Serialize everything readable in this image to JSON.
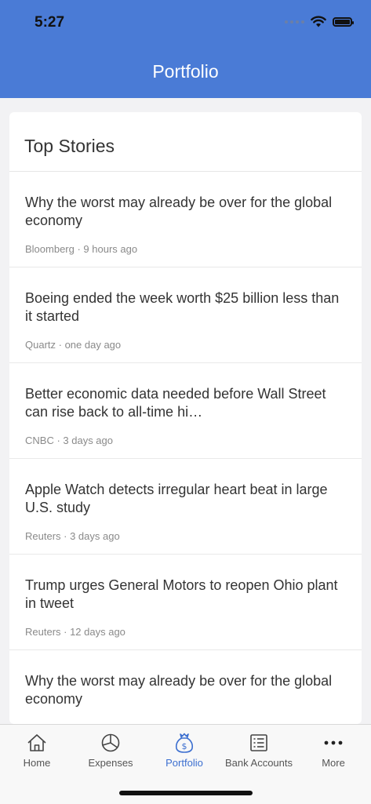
{
  "status_bar": {
    "time": "5:27"
  },
  "header": {
    "title": "Portfolio"
  },
  "section": {
    "title": "Top Stories"
  },
  "stories": [
    {
      "title": "Why the worst may already be over for the global economy",
      "meta": "Bloomberg · 9 hours ago"
    },
    {
      "title": "Boeing ended the week worth $25 billion less than it started",
      "meta": "Quartz · one day ago"
    },
    {
      "title": "Better economic data needed before Wall Street can rise back to all-time hi…",
      "meta": "CNBC · 3 days ago"
    },
    {
      "title": "Apple Watch detects irregular heart beat in large U.S. study",
      "meta": "Reuters · 3 days ago"
    },
    {
      "title": "Trump urges General Motors to reopen Ohio plant in tweet",
      "meta": "Reuters · 12 days ago"
    },
    {
      "title": "Why the worst may already be over for the global economy",
      "meta": ""
    }
  ],
  "tabs": [
    {
      "label": "Home",
      "icon": "home-icon"
    },
    {
      "label": "Expenses",
      "icon": "pie-chart-icon"
    },
    {
      "label": "Portfolio",
      "icon": "money-bag-icon",
      "active": true
    },
    {
      "label": "Bank Accounts",
      "icon": "list-icon"
    },
    {
      "label": "More",
      "icon": "more-icon"
    }
  ],
  "colors": {
    "header": "#4a7bd6",
    "active_tab": "#3c6fd0"
  }
}
